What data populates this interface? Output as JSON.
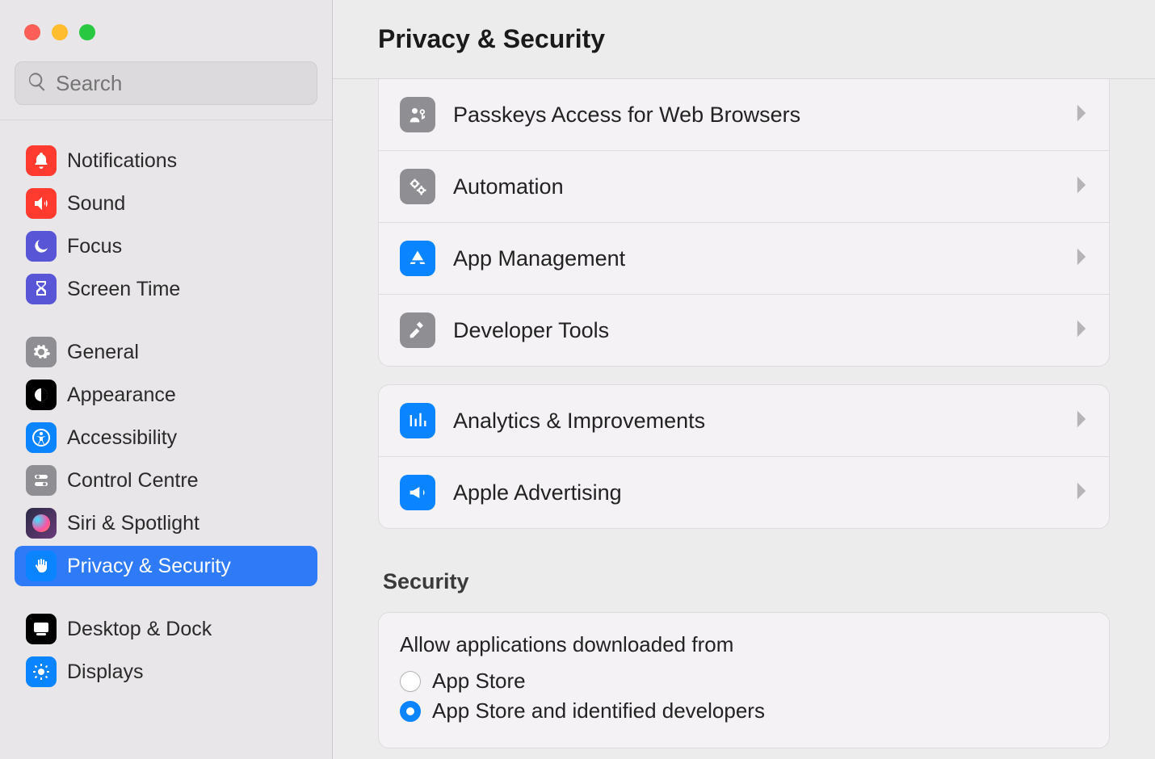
{
  "header": {
    "title": "Privacy & Security"
  },
  "search": {
    "placeholder": "Search",
    "value": ""
  },
  "sidebar": {
    "group1": [
      {
        "label": "Notifications"
      },
      {
        "label": "Sound"
      },
      {
        "label": "Focus"
      },
      {
        "label": "Screen Time"
      }
    ],
    "group2": [
      {
        "label": "General"
      },
      {
        "label": "Appearance"
      },
      {
        "label": "Accessibility"
      },
      {
        "label": "Control Centre"
      },
      {
        "label": "Siri & Spotlight"
      },
      {
        "label": "Privacy & Security"
      }
    ],
    "group3": [
      {
        "label": "Desktop & Dock"
      },
      {
        "label": "Displays"
      }
    ]
  },
  "main": {
    "group_top": [
      {
        "label": "Passkeys Access for Web Browsers"
      },
      {
        "label": "Automation"
      },
      {
        "label": "App Management"
      },
      {
        "label": "Developer Tools"
      }
    ],
    "group_mid": [
      {
        "label": "Analytics & Improvements"
      },
      {
        "label": "Apple Advertising"
      }
    ],
    "security": {
      "heading": "Security",
      "allow_title": "Allow applications downloaded from",
      "options": [
        {
          "label": "App Store",
          "selected": false
        },
        {
          "label": "App Store and identified developers",
          "selected": true
        }
      ]
    }
  }
}
